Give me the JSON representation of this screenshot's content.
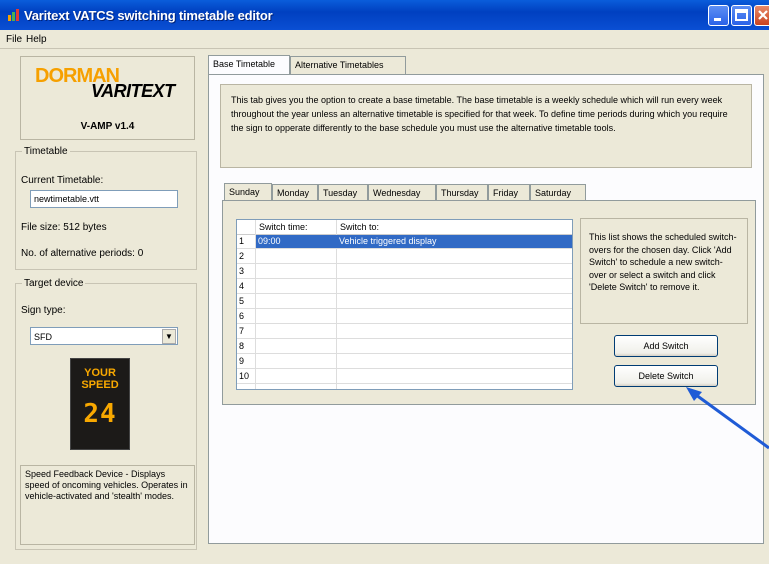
{
  "window": {
    "title": "Varitext VATCS switching timetable editor"
  },
  "menu": {
    "items": [
      "File",
      "Help"
    ]
  },
  "logo": {
    "brand_top": "DORMAN",
    "brand_bottom": "VARITEXT",
    "version": "V-AMP v1.4"
  },
  "timetable": {
    "group_label": "Timetable",
    "current_label": "Current Timetable:",
    "current_value": "newtimetable.vtt",
    "file_size": "File size:  512 bytes",
    "alt_periods": "No. of alternative periods:  0"
  },
  "target_device": {
    "group_label": "Target device",
    "sign_type_label": "Sign type:",
    "sign_type_value": "SFD",
    "sign_image_text_top": "YOUR SPEED",
    "sign_image_number": "24",
    "description": "Speed Feedback Device - Displays speed of oncoming vehicles. Operates in vehicle-activated and 'stealth' modes."
  },
  "main_tabs": [
    "Base Timetable",
    "Alternative Timetables"
  ],
  "base_info": "This tab gives you the option to create a base timetable. The base timetable is a weekly schedule which will run every week throughout the year unless an alternative timetable is specified for that week. To define time periods during which you require the sign to opperate differently to the base schedule you must use the alternative timetable tools.",
  "day_tabs": [
    "Sunday",
    "Monday",
    "Tuesday",
    "Wednesday",
    "Thursday",
    "Friday",
    "Saturday"
  ],
  "grid": {
    "headers": [
      "Switch time:",
      "Switch to:"
    ],
    "rows": [
      {
        "n": "1",
        "time": "09:00",
        "to": "Vehicle triggered display"
      },
      {
        "n": "2",
        "time": "",
        "to": ""
      },
      {
        "n": "3",
        "time": "",
        "to": ""
      },
      {
        "n": "4",
        "time": "",
        "to": ""
      },
      {
        "n": "5",
        "time": "",
        "to": ""
      },
      {
        "n": "6",
        "time": "",
        "to": ""
      },
      {
        "n": "7",
        "time": "",
        "to": ""
      },
      {
        "n": "8",
        "time": "",
        "to": ""
      },
      {
        "n": "9",
        "time": "",
        "to": ""
      },
      {
        "n": "10",
        "time": "",
        "to": ""
      }
    ]
  },
  "help_text": "This list shows the scheduled switch-overs for the chosen day. Click 'Add Switch' to schedule a new switch-over or select a switch and click 'Delete Switch' to remove it.",
  "buttons": {
    "add": "Add Switch",
    "delete": "Delete Switch"
  },
  "colors": {
    "titlebar": "#0A4FD4",
    "selection": "#316AC5",
    "annotation_arrow": "#1F5BD6",
    "logo_orange": "#F6A000"
  }
}
